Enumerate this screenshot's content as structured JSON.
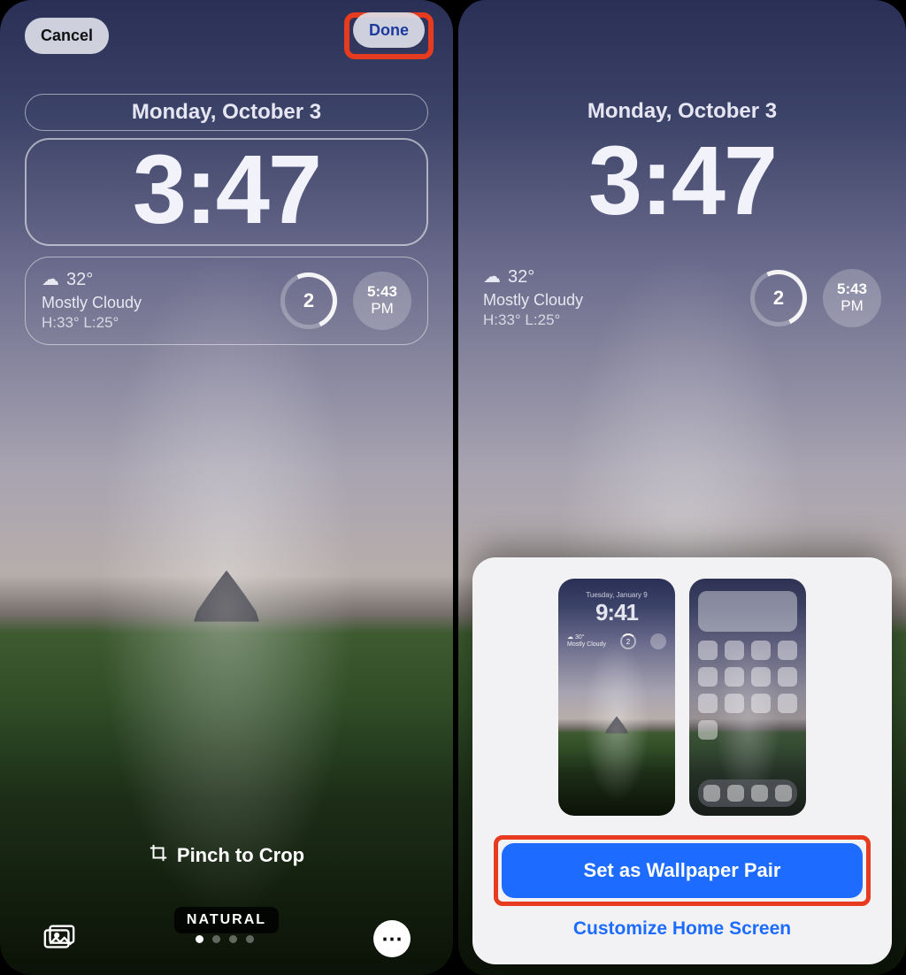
{
  "left": {
    "cancel": "Cancel",
    "done": "Done",
    "date": "Monday, October 3",
    "time": "3:47",
    "weather": {
      "temp": "32°",
      "desc": "Mostly Cloudy",
      "range": "H:33° L:25°"
    },
    "uv": "2",
    "sun": {
      "time": "5:43",
      "period": "PM"
    },
    "crop_hint": "Pinch to Crop",
    "filter": "NATURAL"
  },
  "right": {
    "date": "Monday, October 3",
    "time": "3:47",
    "weather": {
      "temp": "32°",
      "desc": "Mostly Cloudy",
      "range": "H:33° L:25°"
    },
    "uv": "2",
    "sun": {
      "time": "5:43",
      "period": "PM"
    },
    "preview_lock": {
      "date": "Tuesday, January 9",
      "time": "9:41",
      "temp": "30°",
      "desc": "Mostly Cloudy",
      "uv": "2"
    },
    "set_pair": "Set as Wallpaper Pair",
    "customize": "Customize Home Screen"
  }
}
